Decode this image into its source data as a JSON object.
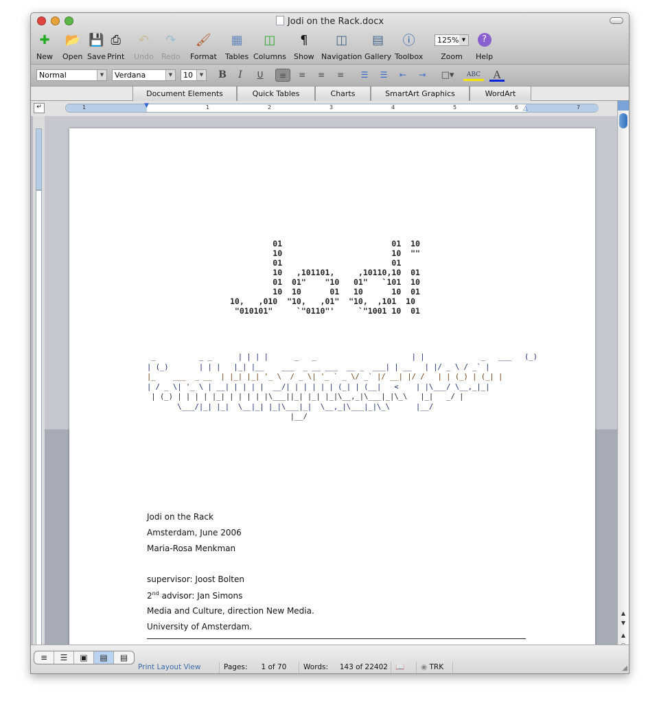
{
  "window": {
    "title": "Jodi on the Rack.docx",
    "colors": {
      "close": "#e0443e",
      "minimize": "#e8a23a",
      "zoom": "#5cb544"
    }
  },
  "toolbar": [
    {
      "label": "New",
      "icon": "new-document-icon"
    },
    {
      "label": "Open",
      "icon": "open-folder-icon"
    },
    {
      "label": "Save",
      "icon": "floppy-disk-icon"
    },
    {
      "label": "Print",
      "icon": "printer-icon"
    },
    {
      "label": "Undo",
      "icon": "undo-icon",
      "disabled": true
    },
    {
      "label": "Redo",
      "icon": "redo-icon",
      "disabled": true
    },
    {
      "label": "Format",
      "icon": "paintbrush-icon"
    },
    {
      "label": "Tables",
      "icon": "table-icon"
    },
    {
      "label": "Columns",
      "icon": "columns-icon"
    },
    {
      "label": "Show",
      "icon": "pilcrow-icon"
    },
    {
      "label": "Navigation",
      "icon": "navigation-pane-icon"
    },
    {
      "label": "Gallery",
      "icon": "gallery-icon"
    },
    {
      "label": "Toolbox",
      "icon": "toolbox-icon"
    },
    {
      "label": "Zoom",
      "value": "125%"
    },
    {
      "label": "Help",
      "icon": "help-icon"
    }
  ],
  "format": {
    "style": "Normal",
    "font": "Verdana",
    "size": "10",
    "bold": "B",
    "italic": "I",
    "underline": "U",
    "highlight_color": "#f5e600",
    "font_color": "#0022dd"
  },
  "ribbon_tabs": [
    "Document Elements",
    "Quick Tables",
    "Charts",
    "SmartArt Graphics",
    "WordArt"
  ],
  "ruler": {
    "numbers": [
      "1",
      "1",
      "2",
      "3",
      "4",
      "5",
      "6",
      "7"
    ]
  },
  "document": {
    "ascii_logo": [
      "         01                       01  10",
      "         10                       10  \"\"",
      "         01                       01",
      "         10   ,101101,     ,10110,10  01",
      "         01  01\"    \"10   01\"   `101  10",
      "         10  10      01   10      10  01",
      "10,   ,010  \"10,   ,01\"  \"10,  ,101  10",
      " \"010101\"     `\"0110\"'     `\"1001 10  01"
    ],
    "ascii_title": [
      " _          _ _      | | | |      _   _                      | |             _   ___   (_)",
      "| (_)       | | |   |_| |__    ___  _ __ ___  __ _  ___| | __   | |/ _ \\ / _` |",
      "|_    ___  _ __  | |_| |_| '_ \\  / _ \\| '_ ` _ \\/ _` |/ __| |/ /   | | (_) | (_| |",
      "| / _ \\| '_ \\ | __| | | | |  __/| | | | | | (_| | (__|   <    | |\\___/ \\__,_|_|",
      " | (_) | | | | |_| | | | | |\\___||_| |_| |_|\\__,_|\\___|_|\\_\\   |_|   _/ |",
      "       \\___/|_| |_|  \\__|_| |_|\\___|_|  \\__,_|\\___|_|\\_\\      |__/",
      "                                 |__/"
    ],
    "lines": [
      "Jodi on the Rack",
      "Amsterdam, June 2006",
      "Maria-Rosa Menkman",
      "supervisor: Joost Bolten",
      "2",
      "nd",
      " advisor: Jan Simons",
      "Media and Culture, direction New Media.",
      "University of Amsterdam."
    ]
  },
  "status": {
    "view": "Print Layout View",
    "pages_label": "Pages:",
    "pages_value": "1 of 70",
    "words_label": "Words:",
    "words_value": "143 of 22402",
    "trk": "TRK"
  }
}
